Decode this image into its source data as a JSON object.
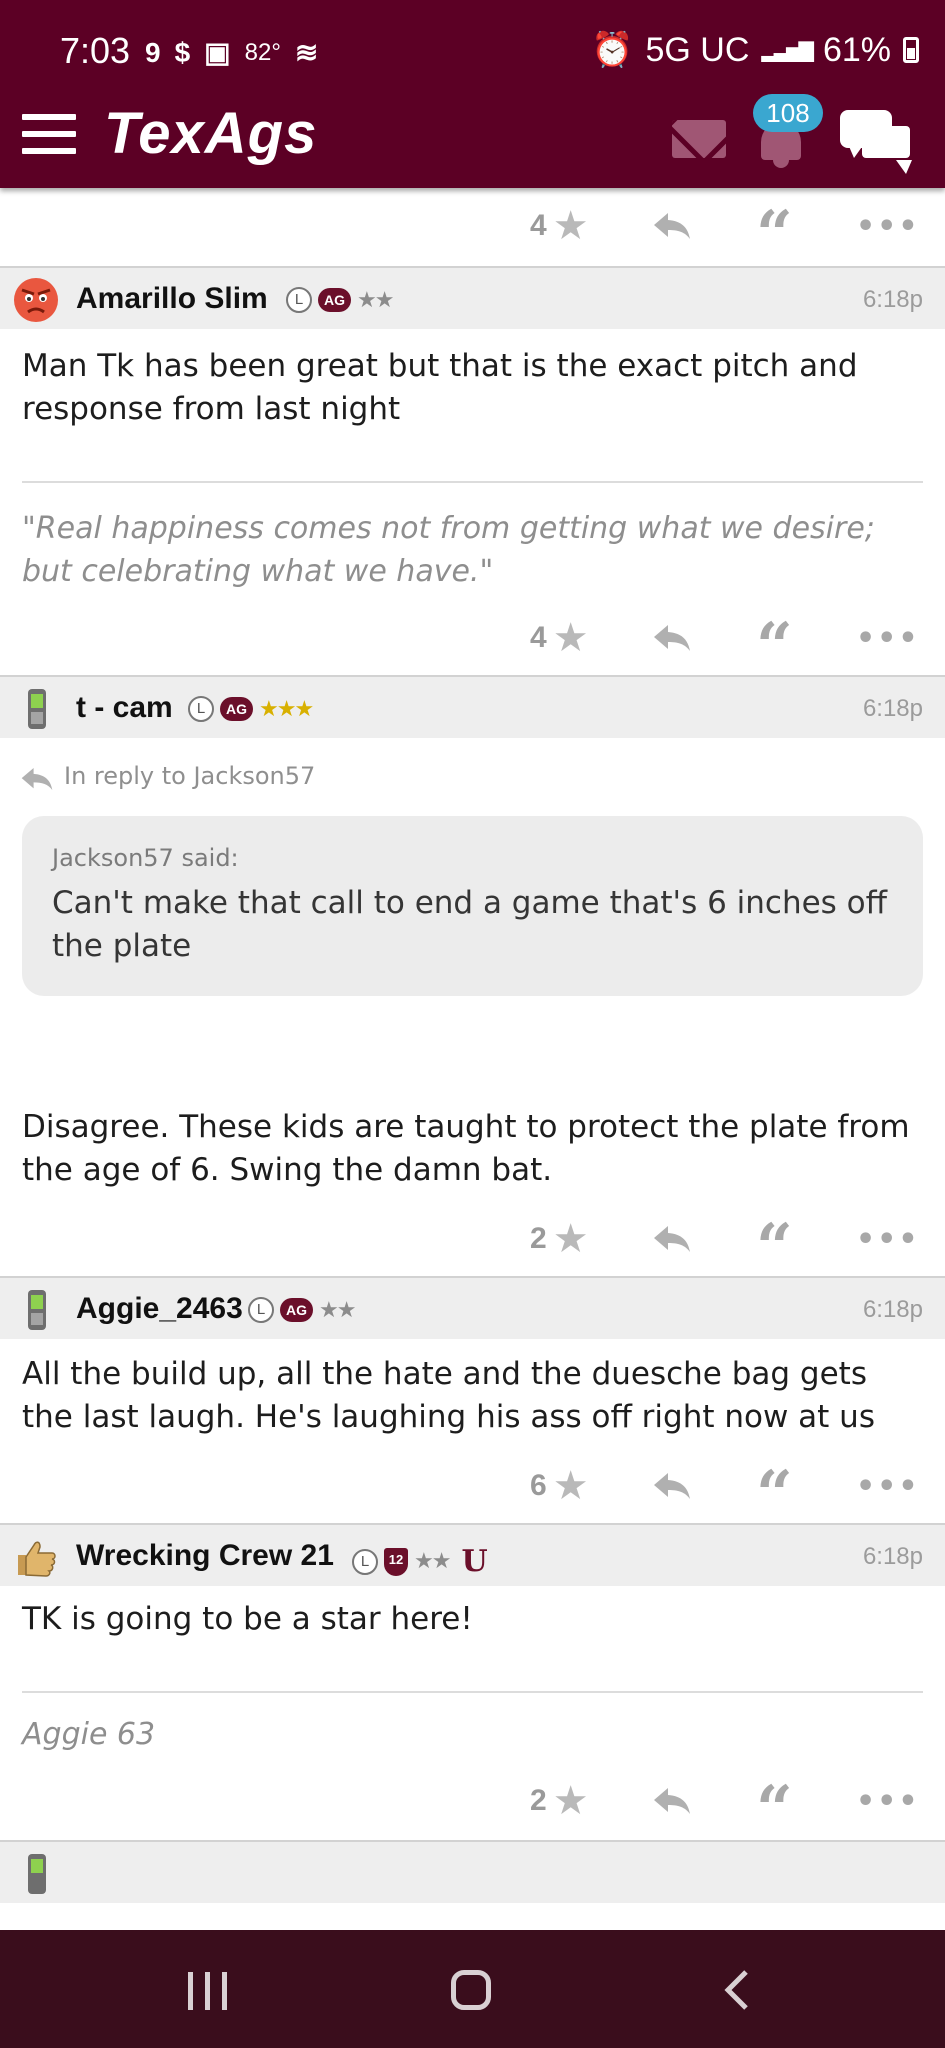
{
  "status_bar": {
    "time": "7:03",
    "temp": "82°",
    "network": "5G UC",
    "battery": "61%"
  },
  "app": {
    "logo": "TexAgs",
    "notification_count": "108",
    "brand_color": "#5c0025"
  },
  "posts": [
    {
      "actions": {
        "stars": "4"
      }
    },
    {
      "username": "Amarillo Slim",
      "time": "6:18p",
      "text": "Man Tk has been great but that is the exact pitch and response from last night",
      "signature": "\"Real happiness comes not from getting what we desire; but celebrating what we have.\"",
      "actions": {
        "stars": "4"
      }
    },
    {
      "username": "t - cam",
      "time": "6:18p",
      "in_reply_to": "In reply to Jackson57",
      "quote_author": "Jackson57 said:",
      "quote_text": "Can't make that call to end a game that's 6 inches off the plate",
      "text": "Disagree. These kids are taught to protect the plate from the age of 6. Swing the damn bat.",
      "actions": {
        "stars": "2"
      }
    },
    {
      "username": "Aggie_2463",
      "time": "6:18p",
      "text": "All the build up, all the hate and the duesche bag gets the last laugh. He's laughing his ass off right now at us",
      "actions": {
        "stars": "6"
      }
    },
    {
      "username": "Wrecking Crew 21",
      "time": "6:18p",
      "text": "TK is going to be a star here!",
      "signature": "Aggie 63",
      "actions": {
        "stars": "2"
      }
    }
  ],
  "badges": {
    "l": "L",
    "ag": "AG",
    "shield": "12",
    "tu": "U"
  },
  "icons": {
    "star": "★",
    "two_stars": "★★",
    "three_stars": "★★★",
    "quote": "“",
    "more": "•••"
  }
}
